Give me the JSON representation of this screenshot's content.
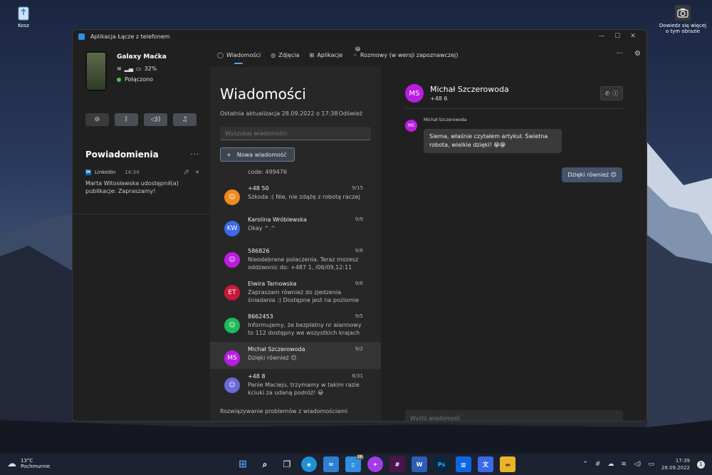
{
  "desktop": {
    "recycle_bin_label": "Kosz",
    "camera_label_line1": "Dowiedz się więcej",
    "camera_label_line2": "o tym obrazie"
  },
  "window": {
    "title": "Aplikacja Łącze z telefonem"
  },
  "device": {
    "name": "Galaxy Maćka",
    "battery": "32%",
    "connection": "Połączono"
  },
  "notifications": {
    "title": "Powiadomienia",
    "items": [
      {
        "app": "LinkedIn",
        "time": "14:34",
        "body": "Marta Witosławska udostępnił(a) publikacje: Zapraszamy!"
      }
    ]
  },
  "nav": {
    "tabs": [
      {
        "label": "Wiadomości",
        "icon": "chat-icon"
      },
      {
        "label": "Zdjęcia",
        "icon": "photos-icon"
      },
      {
        "label": "Aplikacje",
        "icon": "apps-icon"
      },
      {
        "label": "Rozmowy (w wersji zapoznawczej)",
        "icon": "calls-icon",
        "badge": "8"
      }
    ]
  },
  "messages": {
    "title": "Wiadomości",
    "last_update": "Ostatnia aktualizacja 28.09.2022 o 17:38",
    "refresh": "Odśwież",
    "search_placeholder": "Wyszukaj wiadomości",
    "new_message": "Nowa wiadomość",
    "partial_preview": "code: 499476",
    "conversations": [
      {
        "name": "+48 50",
        "date": "9/15",
        "preview": "Szkoda :( Nie, nie zdążę z robotą raczej",
        "initials": "",
        "color": "#f08a1c"
      },
      {
        "name": "Karolina Wróblewska",
        "date": "9/9",
        "preview": "Okay ^.^",
        "initials": "KW",
        "color": "#3a6ae8"
      },
      {
        "name": "586826",
        "date": "9/6",
        "preview": "Nieodebrane polaczenia. Teraz mozesz oddzwonic do: +487          1, /06/09,12:11",
        "initials": "",
        "color": "#b91de0"
      },
      {
        "name": "Elwira Tarnowska",
        "date": "9/6",
        "preview": "Zapraszam również do zjedzenia śniadania :) Dostępne jest na poziomie recep",
        "initials": "ET",
        "color": "#c9183a"
      },
      {
        "name": "8662453",
        "date": "9/5",
        "preview": "Informujemy, że bezpłatny nr alarmowy to 112 dostępny we wszystkich krajach UE. Szc",
        "initials": "",
        "color": "#1fba5a"
      },
      {
        "name": "Michał Szczerowoda",
        "date": "9/2",
        "preview": "Dzięki również 😊",
        "initials": "MS",
        "color": "#b91de0"
      },
      {
        "name": "+48 8",
        "date": "8/31",
        "preview": "Panie Macieju, trzymamy w takim razie kciuki za udaną podróż! 😀",
        "initials": "",
        "color": "#6a6ad8"
      }
    ],
    "troubleshoot": "Rozwiązywanie problemów z wiadomościami"
  },
  "chat": {
    "contact_name": "Michał Szczerowoda",
    "initials": "MS",
    "number": "+48 6",
    "incoming": {
      "sender": "Michał Szczerowoda",
      "text": "Siema, właśnie czytałem artykuł. Świetna robota, wielkie dzięki! 😁😁"
    },
    "outgoing": {
      "text": "Dzięki również 😊"
    },
    "compose_placeholder": "Wyślij wiadomość"
  },
  "taskbar": {
    "temp": "13°C",
    "weather": "Pochmurnie",
    "time": "17:39",
    "date": "28.09.2022",
    "teams_badge": "10",
    "notif_count": "1"
  }
}
